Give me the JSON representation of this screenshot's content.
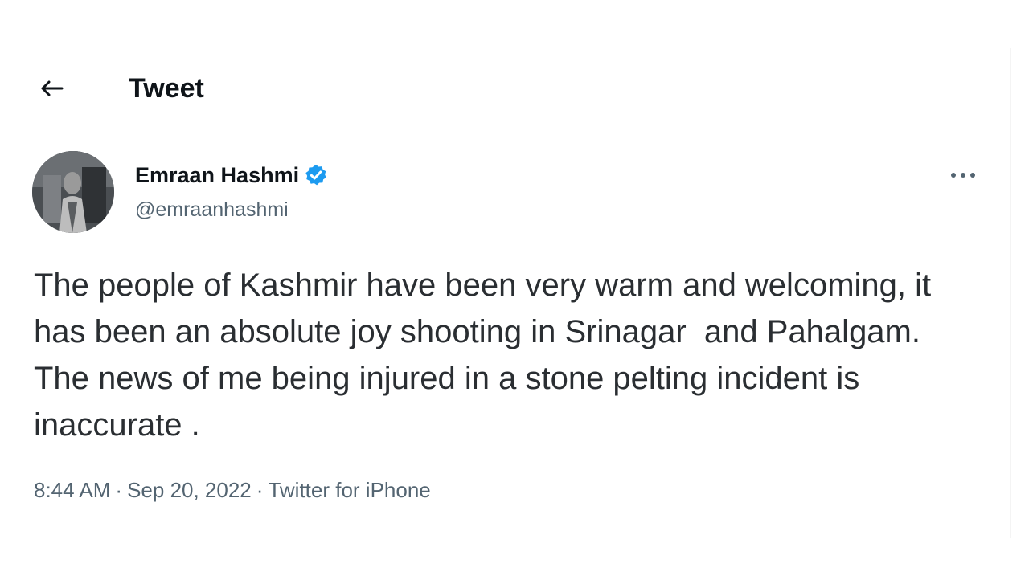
{
  "header": {
    "title": "Tweet",
    "back_icon": "arrow-left-icon"
  },
  "author": {
    "display_name": "Emraan Hashmi",
    "handle": "@emraanhashmi",
    "verified_icon": "verified-badge-icon",
    "verified_color": "#1d9bf0"
  },
  "menu": {
    "more_icon": "more-horizontal-icon"
  },
  "tweet": {
    "text": "The people of Kashmir have been very warm and welcoming, it has been an absolute joy shooting in Srinagar  and Pahalgam. The news of me being injured in a stone pelting incident is inaccurate ."
  },
  "meta": {
    "time": "8:44 AM",
    "separator": "·",
    "date": "Sep 20, 2022",
    "source": "Twitter for iPhone"
  },
  "colors": {
    "text_primary": "#0f1419",
    "text_secondary": "#536471",
    "accent": "#1d9bf0"
  }
}
